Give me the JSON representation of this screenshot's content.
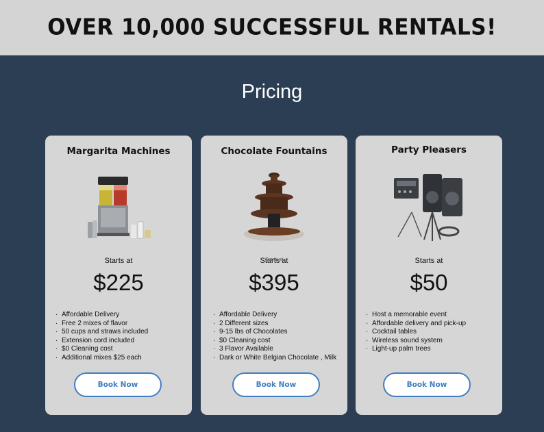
{
  "banner": {
    "headline": "OVER 10,000 SUCCESSFUL RENTALS!"
  },
  "pricing": {
    "title": "Pricing",
    "cards": [
      {
        "title": "Margarita Machines",
        "starts_at": "Starts at",
        "price": "$225",
        "features": [
          "Affordable Delivery",
          "Free 2 mixes of flavor",
          "50 cups and straws included",
          "Extension cord included",
          "$0 Cleaning cost",
          "Additional mixes  $25 each"
        ],
        "button": "Book Now",
        "image_icon": "margarita-machine-icon"
      },
      {
        "title": "Chocolate Fountains",
        "starts_at": "Starts at",
        "starts_at_overlay": "Starts at",
        "price": "$395",
        "features": [
          "Affordable Delivery",
          "2 Different sizes",
          "9-15 lbs of Chocolates",
          "$0 Cleaning cost",
          "3 Flavor Available",
          "Dark or White Belgian Chocolate , Milk"
        ],
        "button": "Book Now",
        "image_icon": "chocolate-fountain-icon"
      },
      {
        "title": "Party Pleasers",
        "starts_at": "Starts at",
        "price": "$50",
        "features": [
          "Host a memorable event",
          "Affordable delivery and pick-up",
          "Cocktail tables",
          "Wireless sound system",
          "Light-up palm trees"
        ],
        "button": "Book Now",
        "image_icon": "sound-system-icon"
      }
    ]
  },
  "colors": {
    "page_background": "#2c3e53",
    "banner_background": "#d4d4d4",
    "card_background": "#d6d6d6",
    "button_accent": "#3f7ec2"
  }
}
